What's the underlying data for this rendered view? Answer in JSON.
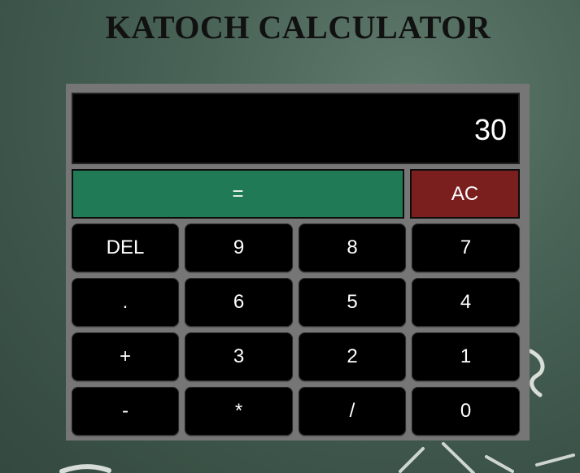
{
  "app": {
    "title": "KATOCH CALCULATOR"
  },
  "display": {
    "value": "30"
  },
  "buttons": {
    "equals": "=",
    "ac": "AC",
    "rows": [
      [
        "DEL",
        "9",
        "8",
        "7"
      ],
      [
        ".",
        "6",
        "5",
        "4"
      ],
      [
        "+",
        "3",
        "2",
        "1"
      ],
      [
        "-",
        "*",
        "/",
        "0"
      ]
    ]
  },
  "colors": {
    "equals": "#1f7a55",
    "ac": "#7a1e1e",
    "frame": "#767676"
  }
}
